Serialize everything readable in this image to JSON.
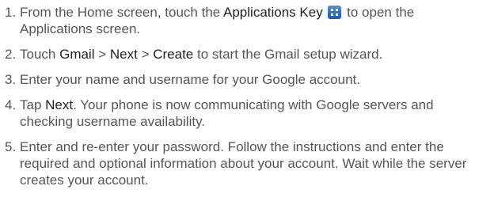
{
  "steps": [
    {
      "number": "1.",
      "part1": "From the Home screen, touch the ",
      "bold1": "Applications Key",
      "icon": "applications-key-icon",
      "part2": " to open the Applications screen."
    },
    {
      "number": "2.",
      "part1": "Touch ",
      "bold1": "Gmail",
      "sep1": " > ",
      "bold2": "Next",
      "sep2": " > ",
      "bold3": "Create",
      "part2": " to start the Gmail setup wizard."
    },
    {
      "number": "3.",
      "text": "Enter your name and username for your Google account."
    },
    {
      "number": "4.",
      "part1": "Tap ",
      "bold1": "Next",
      "part2": ". Your phone is now communicating with Google servers and checking username availability."
    },
    {
      "number": "5.",
      "text": "Enter and re-enter your password. Follow the instructions and enter the required and optional information about your account. Wait while the server creates your account."
    }
  ]
}
